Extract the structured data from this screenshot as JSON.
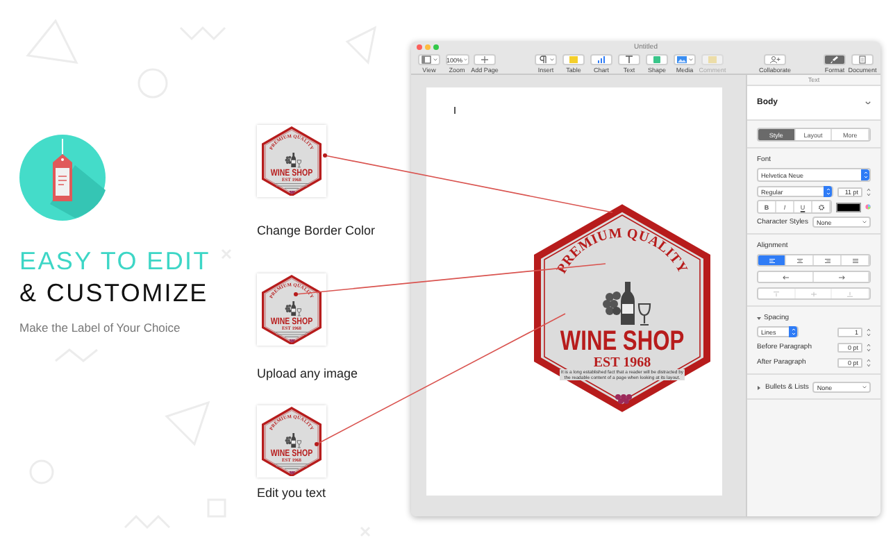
{
  "promo": {
    "headline_1": "EASY TO EDIT",
    "headline_2": "& CUSTOMIZE",
    "subtitle": "Make the Label of Your Choice"
  },
  "features": [
    {
      "caption": "Change Border Color",
      "label": {
        "tagline": "PREMIUM QUALITY",
        "title": "WINE SHOP",
        "year": "EST 1968"
      }
    },
    {
      "caption": "Upload any image",
      "label": {
        "tagline": "PREMIUM QUALITY",
        "title": "WINE SHOP",
        "year": "EST 1968"
      }
    },
    {
      "caption": "Edit you text",
      "label": {
        "tagline": "PREMIUM QUALITY",
        "title": "WINE SHOP",
        "year": "EST 1968"
      }
    }
  ],
  "window": {
    "title": "Untitled",
    "toolbar": {
      "left": [
        {
          "kind": "view",
          "label": "View"
        },
        {
          "kind": "zoom",
          "label": "Zoom",
          "value": "100%"
        },
        {
          "kind": "add",
          "label": "Add Page"
        }
      ],
      "center": [
        {
          "kind": "insert",
          "label": "Insert",
          "disabled": false
        },
        {
          "kind": "table",
          "label": "Table",
          "disabled": false
        },
        {
          "kind": "chart",
          "label": "Chart",
          "disabled": false
        },
        {
          "kind": "text",
          "label": "Text",
          "disabled": false
        },
        {
          "kind": "shape",
          "label": "Shape",
          "disabled": false
        },
        {
          "kind": "media",
          "label": "Media",
          "disabled": false
        },
        {
          "kind": "comment",
          "label": "Comment",
          "disabled": true
        }
      ],
      "collaborate": {
        "label": "Collaborate"
      },
      "right": [
        {
          "kind": "format",
          "label": "Format",
          "selected": true
        },
        {
          "kind": "document",
          "label": "Document",
          "selected": false
        }
      ]
    },
    "document": {
      "label": {
        "tagline": "PREMIUM QUALITY",
        "title": "WINE SHOP",
        "year": "EST 1968",
        "body": "It is a long established fact that a reader will be distracted by the readable content of a page when looking at its layout."
      }
    },
    "inspector": {
      "header": "Text",
      "paragraph_style": "Body",
      "tabs": [
        {
          "label": "Style",
          "selected": true
        },
        {
          "label": "Layout",
          "selected": false
        },
        {
          "label": "More",
          "selected": false
        }
      ],
      "font": {
        "heading": "Font",
        "family": "Helvetica Neue",
        "typeface": "Regular",
        "size": "11 pt",
        "styles": [
          {
            "kind": "bold",
            "label": "B"
          },
          {
            "kind": "italic",
            "label": "I"
          },
          {
            "kind": "underline",
            "label": "U"
          }
        ],
        "character_styles_label": "Character Styles",
        "character_styles": "None"
      },
      "alignment": {
        "heading": "Alignment",
        "horizontal": [
          {
            "kind": "left",
            "selected": true
          },
          {
            "kind": "center",
            "selected": false
          },
          {
            "kind": "right",
            "selected": false
          },
          {
            "kind": "justify",
            "selected": false
          }
        ],
        "indent": [
          {
            "kind": "decrease"
          },
          {
            "kind": "increase"
          }
        ],
        "vertical": [
          {
            "kind": "top",
            "disabled": true
          },
          {
            "kind": "middle",
            "disabled": true
          },
          {
            "kind": "bottom",
            "disabled": true
          }
        ]
      },
      "spacing": {
        "heading": "Spacing",
        "expanded": true,
        "line_mode": "Lines",
        "line_value": "1",
        "rows": [
          {
            "label": "Before Paragraph",
            "value": "0 pt"
          },
          {
            "label": "After Paragraph",
            "value": "0 pt"
          }
        ]
      },
      "bullets": {
        "heading": "Bullets & Lists",
        "expanded": false,
        "value": "None"
      }
    }
  }
}
